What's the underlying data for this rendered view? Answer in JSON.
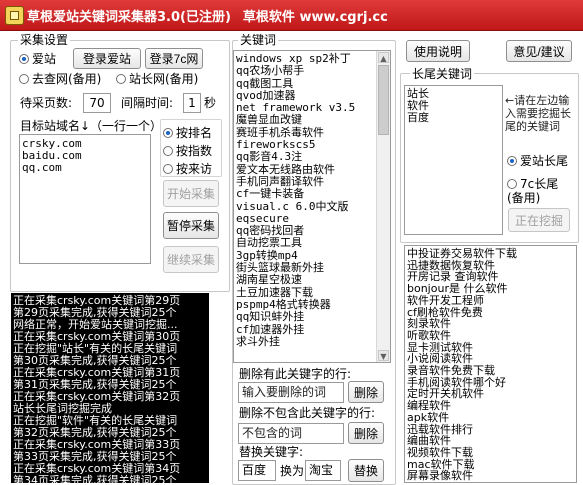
{
  "title": {
    "app": "草根爱站关键词采集器3.0(已注册)",
    "vendor": "草根软件 www.cgrj.cc"
  },
  "settings": {
    "group_title": "采集设置",
    "login_aizhan": "登录爱站",
    "login_7c": "登录7c网",
    "source_aizhan": "爱站",
    "source_quwang": "去查网(备用)",
    "source_zhanzhang": "站长网(备用)",
    "pages_label": "待采页数:",
    "pages_value": "70",
    "interval_label": "间隔时间:",
    "interval_value": "1",
    "interval_unit": "秒",
    "domains_label": "目标站域名↓（一行一个）",
    "domains": [
      "crsky.com",
      "baidu.com",
      "qq.com"
    ],
    "sort_rank": "按排名",
    "sort_index": "按指数",
    "sort_visit": "按来访",
    "start_btn": "开始采集",
    "pause_btn": "暂停采集",
    "resume_btn": "继续采集"
  },
  "log": {
    "lines": [
      "正在采集crsky.com关键词第29页",
      "第29页采集完成,获得关键词25个",
      "网络正常，开始爱站关键词挖掘...",
      "正在采集crsky.com关键词第30页",
      "正在挖掘\"站长\"有关的长尾关键词",
      "第30页采集完成,获得关键词25个",
      "正在采集crsky.com关键词第31页",
      "第31页采集完成,获得关键词25个",
      "正在采集crsky.com关键词第32页",
      "站长长尾词挖掘完成",
      "正在挖掘\"软件\"有关的长尾关键词",
      "第32页采集完成,获得关键词25个",
      "正在采集crsky.com关键词第33页",
      "第33页采集完成,获得关键词25个",
      "正在采集crsky.com关键词第34页",
      "第34页采集完成,获得关键词25个"
    ]
  },
  "keywords": {
    "group_title": "关键词",
    "items": [
      "windows xp sp2补丁",
      "qq农场小帮手",
      "qq截图工具",
      "qvod加速器",
      "net framework v3.5",
      "魔兽显血改键",
      "赛班手机杀毒软件",
      "fireworkscs5",
      "qq影音4.3注",
      "爱文本无线路由软件",
      "手机同声翻译软件",
      "cf一键卡装备",
      "visual.c 6.0中文版",
      "eqsecure",
      "qq密码找回者",
      "自动挖票工具",
      "3gp转换mp4",
      "街头篮球最新外挂",
      "湖南星空极速",
      "土豆加速器下载",
      "pspmp4格式转换器",
      "qq知识蚌外挂",
      "cf加速器外挂",
      "求斗外挂"
    ],
    "del_contain_label": "删除有此关键字的行:",
    "del_contain_placeholder": "输入要删除的词",
    "del_contain_btn": "删除",
    "del_not_label": "删除不包含此关键字的行:",
    "del_not_placeholder": "不包含的词",
    "del_not_btn": "删除",
    "replace_label": "替换关键字:",
    "replace_from": "百度",
    "replace_to_label": "换为",
    "replace_to": "淘宝",
    "replace_btn": "替换"
  },
  "right": {
    "help_btn": "使用说明",
    "feedback_btn": "意见/建议",
    "group_title": "长尾关键词",
    "seeds": [
      "站长",
      "软件",
      "百度"
    ],
    "hint": "←请在左边输入需要挖掘长尾的关键词",
    "opt_aizhan": "爱站长尾",
    "opt_7c": "7c长尾(备用)",
    "mining_btn": "正在挖掘",
    "results": [
      "中投证券交易软件下载",
      "迅捷数据恢复软件",
      "开房记录 查询软件",
      "bonjour是 什么软件",
      "软件开发工程师",
      "cf刷枪软件免费",
      "刻录软件",
      "听歌软件",
      "显卡测试软件",
      "小说阅读软件",
      "录音软件免费下载",
      "手机阅读软件哪个好",
      "定时开关机软件",
      "编程软件",
      "apk软件",
      "迅载软件排行",
      "编曲软件",
      "视频软件下载",
      "mac软件下载",
      "屏幕录像软件"
    ]
  }
}
